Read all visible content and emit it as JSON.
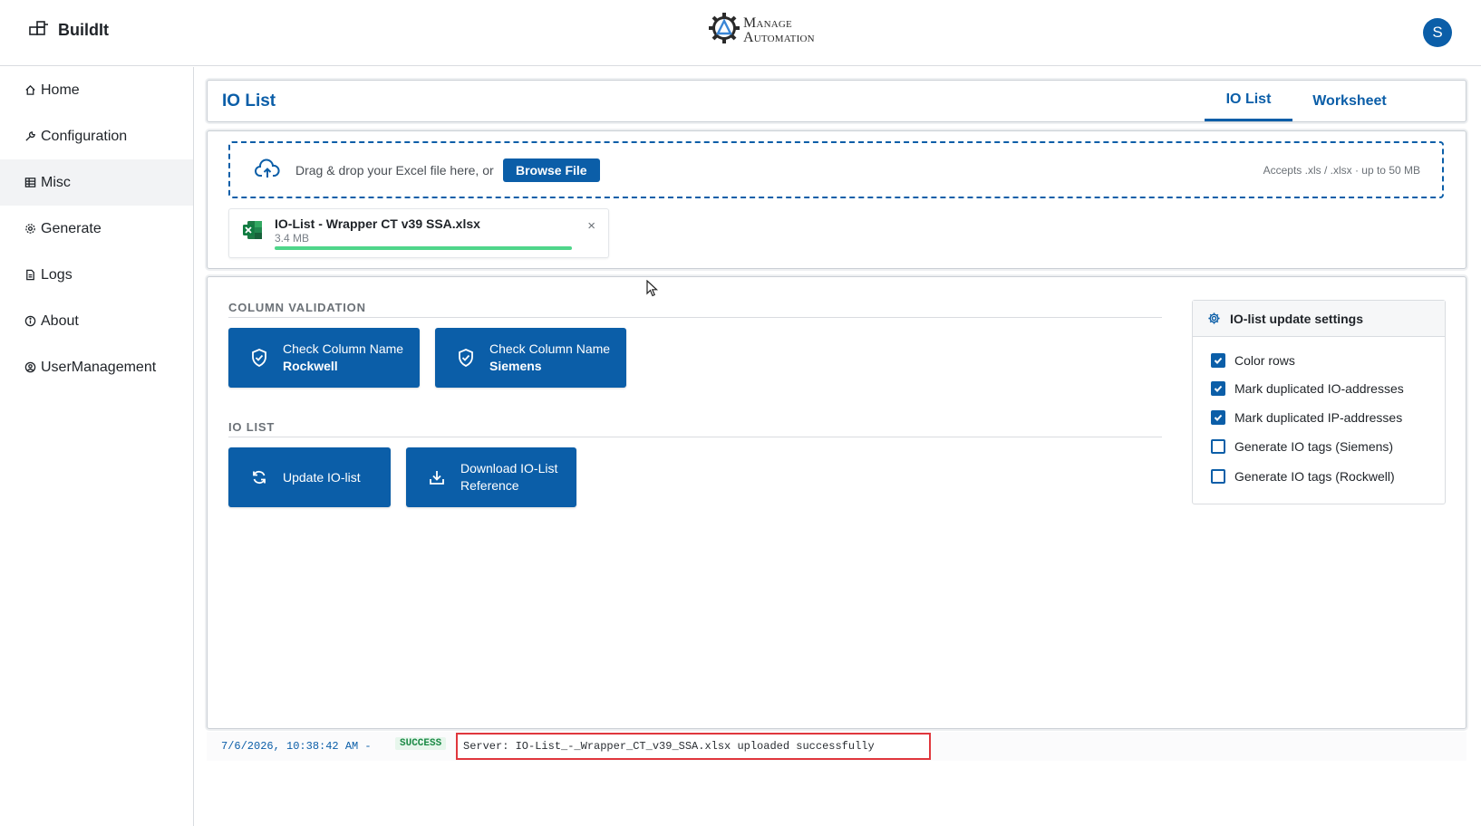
{
  "app": {
    "name": "BuildIt",
    "logo_line1": "Manage",
    "logo_line2": "Automation",
    "avatar_initial": "S"
  },
  "sidebar": {
    "items": [
      {
        "label": "Home",
        "icon": "home-icon"
      },
      {
        "label": "Configuration",
        "icon": "wrench-icon"
      },
      {
        "label": "Misc",
        "icon": "table-icon",
        "active": true
      },
      {
        "label": "Generate",
        "icon": "gear-icon"
      },
      {
        "label": "Logs",
        "icon": "document-icon"
      },
      {
        "label": "About",
        "icon": "info-icon"
      },
      {
        "label": "UserManagement",
        "icon": "user-circle-icon"
      }
    ]
  },
  "header": {
    "title": "IO List",
    "tabs": [
      "IO List",
      "Worksheet"
    ],
    "active_tab": "IO List"
  },
  "upload": {
    "drop_text": "Drag & drop your Excel file here, or",
    "browse_label": "Browse File",
    "accepts": "Accepts .xls / .xlsx  ·  up to 50 MB",
    "file": {
      "name": "IO-List - Wrapper CT v39 SSA.xlsx",
      "size": "3.4 MB",
      "progress": 1.0,
      "close": "×"
    }
  },
  "column_validation": {
    "heading": "COLUMN VALIDATION",
    "buttons": [
      {
        "line1": "Check Column Name",
        "line2": "Rockwell"
      },
      {
        "line1": "Check Column Name",
        "line2": "Siemens"
      }
    ]
  },
  "io_list": {
    "heading": "IO LIST",
    "update_label": "Update IO-list",
    "download_line1": "Download IO-List",
    "download_line2": "Reference"
  },
  "settings": {
    "title": "IO-list update settings",
    "options": [
      {
        "label": "Color rows",
        "checked": true
      },
      {
        "label": "Mark duplicated IO-addresses",
        "checked": true
      },
      {
        "label": "Mark duplicated IP-addresses",
        "checked": true
      },
      {
        "label": "Generate IO tags (Siemens)",
        "checked": false
      },
      {
        "label": "Generate IO tags (Rockwell)",
        "checked": false
      }
    ]
  },
  "log": {
    "timestamp": "7/6/2026, 10:38:42 AM -",
    "status": "SUCCESS",
    "message": "Server: IO-List_-_Wrapper_CT_v39_SSA.xlsx uploaded successfully"
  },
  "colors": {
    "primary": "#0b5ea8",
    "success": "#1a8a45",
    "progress": "#4fd68a",
    "highlight": "#e0373d"
  }
}
